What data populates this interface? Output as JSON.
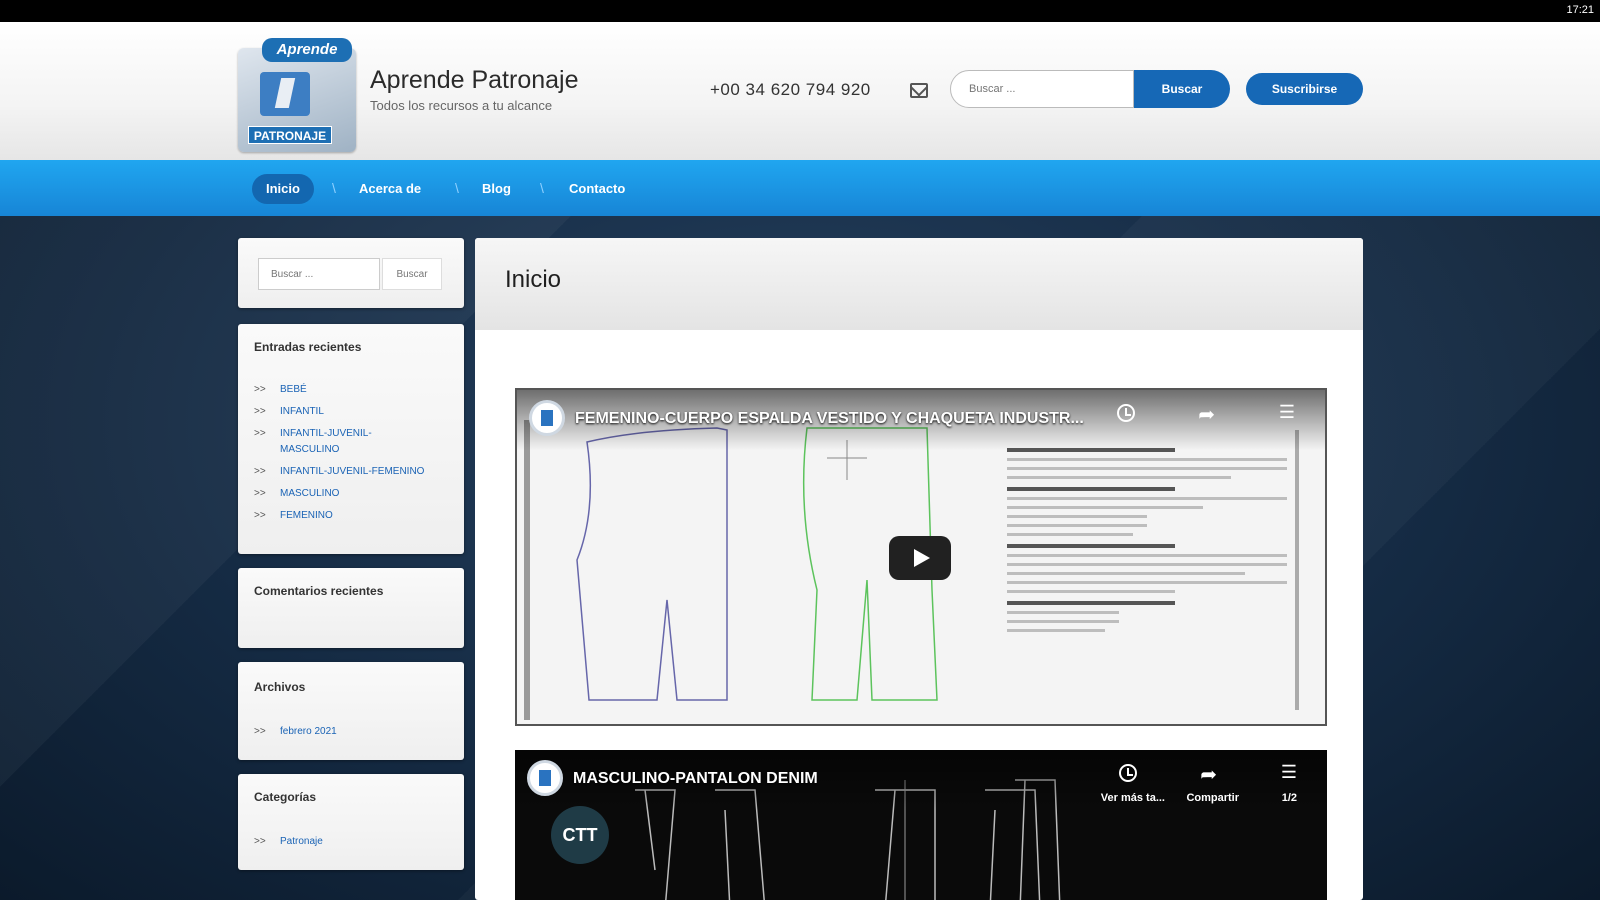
{
  "status_bar": {
    "time": "17:21"
  },
  "header": {
    "logo": {
      "top_text": "Aprende",
      "bottom_text": "PATRONAJE"
    },
    "site_title": "Aprende Patronaje",
    "tagline": "Todos los recursos a tu alcance",
    "phone": "+00 34 620 794 920",
    "search_placeholder": "Buscar ...",
    "search_button": "Buscar",
    "subscribe_button": "Suscribirse"
  },
  "nav": {
    "items": [
      {
        "label": "Inicio",
        "active": true
      },
      {
        "label": "Acerca de",
        "active": false
      },
      {
        "label": "Blog",
        "active": false
      },
      {
        "label": "Contacto",
        "active": false
      }
    ],
    "separator": "\\"
  },
  "sidebar": {
    "search": {
      "placeholder": "Buscar ...",
      "button": "Buscar"
    },
    "recent_posts": {
      "title": "Entradas recientes",
      "items": [
        "BEBÉ",
        "INFANTIL",
        "INFANTIL-JUVENIL-MASCULINO",
        "INFANTIL-JUVENIL-FEMENINO",
        "MASCULINO",
        "FEMENINO"
      ]
    },
    "recent_comments": {
      "title": "Comentarios recientes"
    },
    "archives": {
      "title": "Archivos",
      "items": [
        "febrero 2021"
      ]
    },
    "categories": {
      "title": "Categorías",
      "items": [
        "Patronaje"
      ]
    },
    "chevron": ">>"
  },
  "main": {
    "page_title": "Inicio",
    "videos": [
      {
        "title": "FEMENINO-CUERPO ESPALDA VESTIDO Y CHAQUETA INDUSTR..."
      },
      {
        "title": "MASCULINO-PANTALON DENIM",
        "watch_later": "Ver más ta...",
        "share": "Compartir",
        "playlist_count": "1/2",
        "channel_badge": "CTT"
      }
    ]
  },
  "colors": {
    "accent": "#1668b6",
    "nav_top": "#20a6f0",
    "nav_bottom": "#1785d6",
    "link": "#1a63b5"
  }
}
